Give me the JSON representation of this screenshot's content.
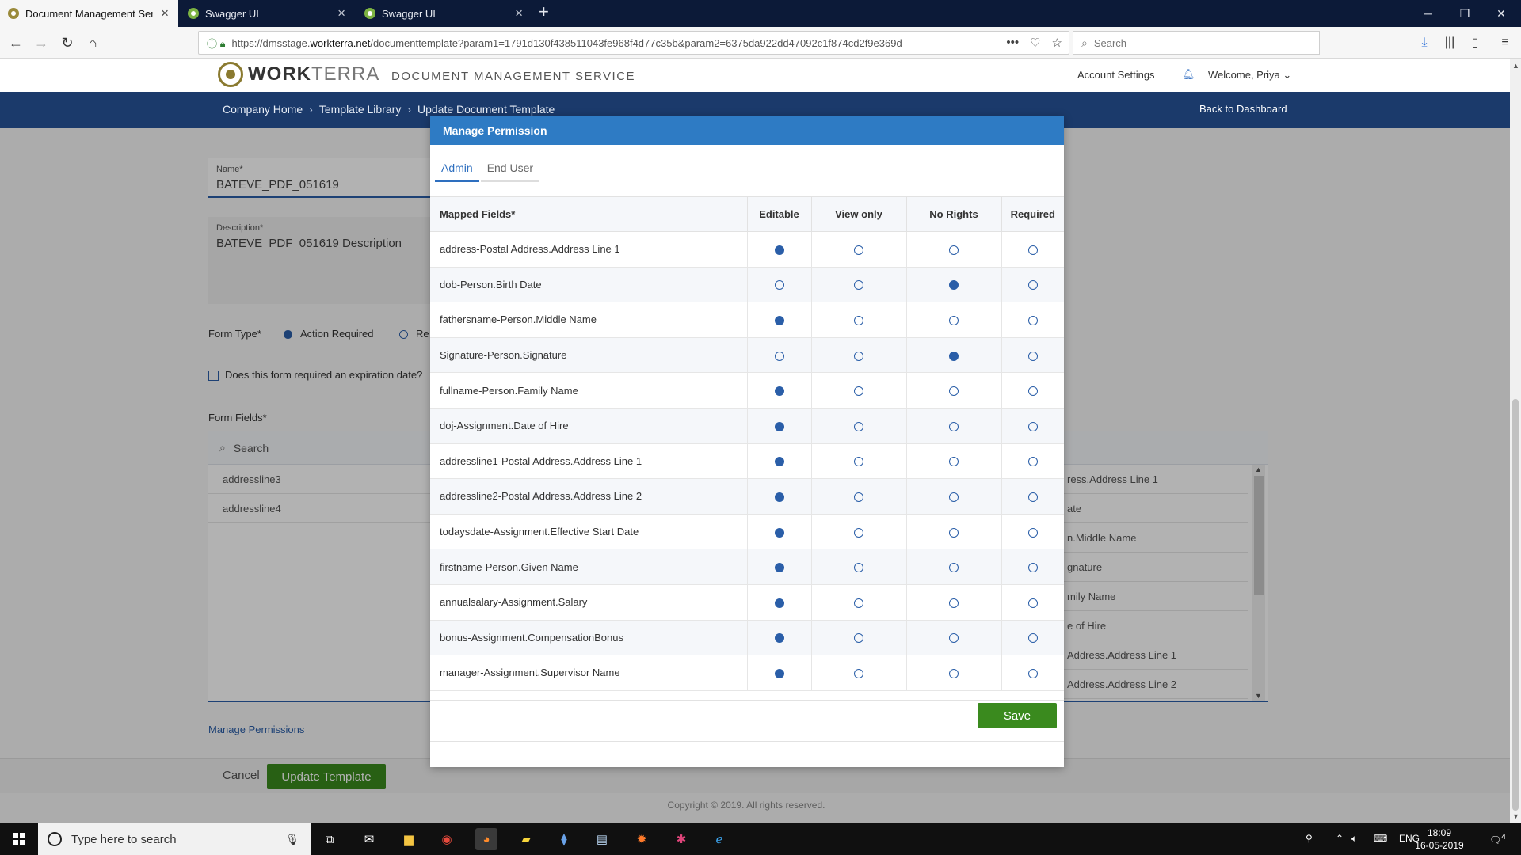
{
  "browser": {
    "tabs": [
      {
        "title": "Document Management Servic",
        "active": true
      },
      {
        "title": "Swagger UI",
        "active": false
      },
      {
        "title": "Swagger UI",
        "active": false
      }
    ],
    "url_prefix": "https://dmsstage.",
    "url_domain": "workterra.net",
    "url_rest": "/documenttemplate?param1=1791d130f438511043fe968f4d77c35b&param2=6375da922dd47092c1f874cd2f9e369d",
    "search_placeholder": "Search"
  },
  "header": {
    "brand_bold": "WORK",
    "brand_light": "TERRA",
    "service_name": "DOCUMENT MANAGEMENT SERVICE",
    "account_settings": "Account Settings",
    "welcome": "Welcome, Priya"
  },
  "breadcrumb": {
    "items": [
      "Company Home",
      "Template Library",
      "Update Document Template"
    ],
    "back_link": "Back to Dashboard"
  },
  "form": {
    "name_label": "Name*",
    "name_value": "BATEVE_PDF_051619",
    "description_label": "Description*",
    "description_value": "BATEVE_PDF_051619 Description",
    "form_type_label": "Form Type*",
    "form_type_option_1": "Action Required",
    "form_type_option_2": "Re",
    "expiration_label": "Does this form required an expiration date?",
    "form_fields_label": "Form Fields*",
    "search_placeholder": "Search",
    "left_items": [
      "addressline3",
      "addressline4"
    ],
    "right_items": [
      "ress.Address Line 1",
      "ate",
      "n.Middle Name",
      "gnature",
      "mily Name",
      "e of Hire",
      "Address.Address Line 1",
      "Address.Address Line 2"
    ],
    "manage_permissions": "Manage Permissions",
    "cancel": "Cancel",
    "update_template": "Update Template",
    "copyright": "Copyright © 2019. All rights reserved."
  },
  "modal": {
    "title": "Manage Permission",
    "tabs": [
      "Admin",
      "End User"
    ],
    "columns": [
      "Mapped Fields*",
      "Editable",
      "View only",
      "No Rights",
      "Required"
    ],
    "rows": [
      {
        "field": "address-Postal Address.Address Line 1",
        "selected": 0
      },
      {
        "field": "dob-Person.Birth Date",
        "selected": 2
      },
      {
        "field": "fathersname-Person.Middle Name",
        "selected": 0
      },
      {
        "field": "Signature-Person.Signature",
        "selected": 2
      },
      {
        "field": "fullname-Person.Family Name",
        "selected": 0
      },
      {
        "field": "doj-Assignment.Date of Hire",
        "selected": 0
      },
      {
        "field": "addressline1-Postal Address.Address Line 1",
        "selected": 0
      },
      {
        "field": "addressline2-Postal Address.Address Line 2",
        "selected": 0
      },
      {
        "field": "todaysdate-Assignment.Effective Start Date",
        "selected": 0
      },
      {
        "field": "firstname-Person.Given Name",
        "selected": 0
      },
      {
        "field": "annualsalary-Assignment.Salary",
        "selected": 0
      },
      {
        "field": "bonus-Assignment.CompensationBonus",
        "selected": 0
      },
      {
        "field": "manager-Assignment.Supervisor Name",
        "selected": 0
      }
    ],
    "save": "Save"
  },
  "taskbar": {
    "search_placeholder": "Type here to search",
    "language": "ENG",
    "time": "18:09",
    "date": "16-05-2019",
    "notifications": "4"
  },
  "colors": {
    "accent": "#2a5ea8",
    "modal_header": "#2e7bc4",
    "nav_dark": "#1b3a6b",
    "save_green": "#3a8a1e"
  }
}
